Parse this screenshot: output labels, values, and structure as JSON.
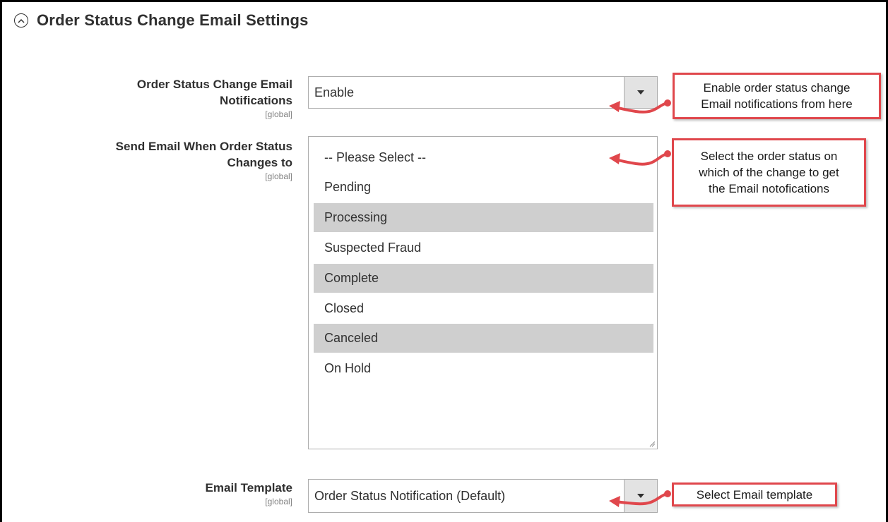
{
  "section": {
    "title": "Order Status Change Email Settings"
  },
  "fields": {
    "notifications": {
      "label_line1": "Order Status Change Email",
      "label_line2": "Notifications",
      "scope": "[global]",
      "value": "Enable"
    },
    "send_when": {
      "label_line1": "Send Email When Order Status",
      "label_line2": "Changes to",
      "scope": "[global]",
      "options": [
        {
          "label": "-- Please Select --",
          "selected": false
        },
        {
          "label": "Pending",
          "selected": false
        },
        {
          "label": "Processing",
          "selected": true
        },
        {
          "label": "Suspected Fraud",
          "selected": false
        },
        {
          "label": "Complete",
          "selected": true
        },
        {
          "label": "Closed",
          "selected": false
        },
        {
          "label": "Canceled",
          "selected": true
        },
        {
          "label": "On Hold",
          "selected": false
        }
      ]
    },
    "template": {
      "label": "Email Template",
      "scope": "[global]",
      "value": "Order Status Notification (Default)"
    }
  },
  "callouts": {
    "notifications": {
      "line1": "Enable order status change",
      "line2": "Email notifications from here"
    },
    "send_when": {
      "line1": "Select the order status on",
      "line2": "which of the change to get",
      "line3": "the Email notofications"
    },
    "template": {
      "line1": "Select Email template"
    }
  },
  "colors": {
    "callout_border": "#e0474c",
    "selected_option": "#cfcfcf"
  },
  "icons": {
    "collapse": "chevron-up-circle-icon",
    "dropdown": "triangle-down-icon"
  }
}
